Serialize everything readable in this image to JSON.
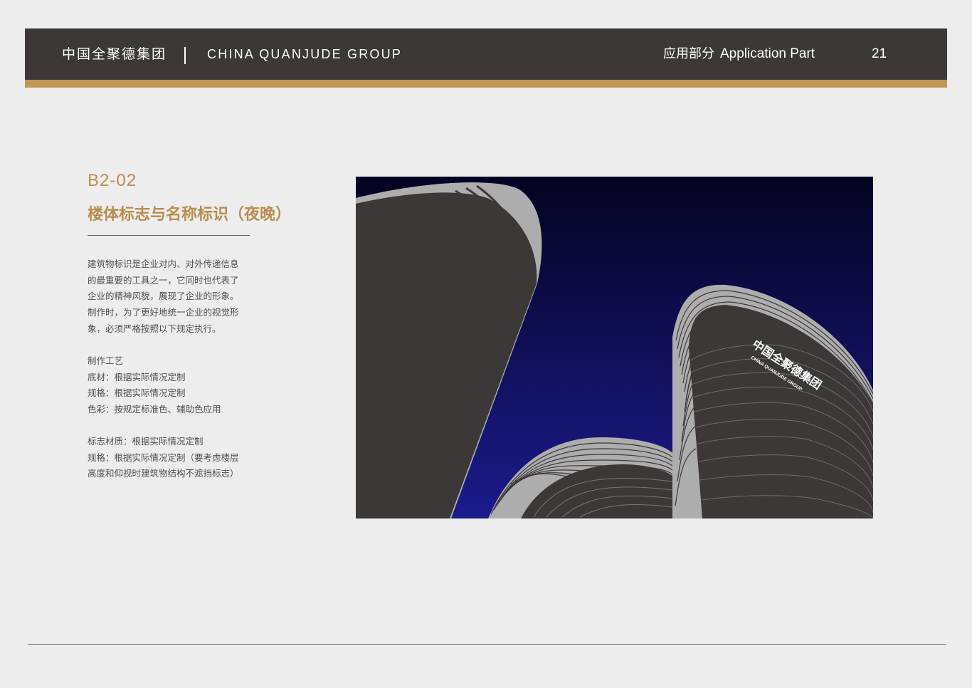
{
  "header": {
    "brand_cn": "中国全聚德集团",
    "brand_en": "CHINA QUANJUDE GROUP",
    "section_cn": "应用部分",
    "section_en": "Application Part",
    "page_number": "21"
  },
  "content": {
    "code": "B2-02",
    "title": "楼体标志与名称标识（夜晚）",
    "paragraph1": [
      "建筑物标识是企业对内、对外传递信息",
      "的最重要的工具之一，它同时也代表了",
      "企业的精神风貌，展现了企业的形象。",
      "制作时，为了更好地统一企业的视觉形",
      "象，必须严格按照以下规定执行。"
    ],
    "paragraph2": [
      "制作工艺",
      "底材：根据实际情况定制",
      "规格：根据实际情况定制",
      "色彩：按规定标准色、辅助色应用"
    ],
    "paragraph3": [
      "标志材质：根据实际情况定制",
      "规格：根据实际情况定制（要考虑楼层",
      "高度和仰视时建筑物结构不遮挡标志）"
    ]
  },
  "illustration": {
    "sign_cn": "中国全聚德集团",
    "sign_en": "CHINA QUANJUDE GROUP"
  },
  "colors": {
    "header_bg": "#3c3837",
    "accent_gold": "#c39655",
    "title_gold": "#b88d4d",
    "sky_top": "#050321",
    "sky_bottom": "#1b1b8c",
    "building_dark": "#3c3837",
    "building_silver": "#aeadae"
  }
}
